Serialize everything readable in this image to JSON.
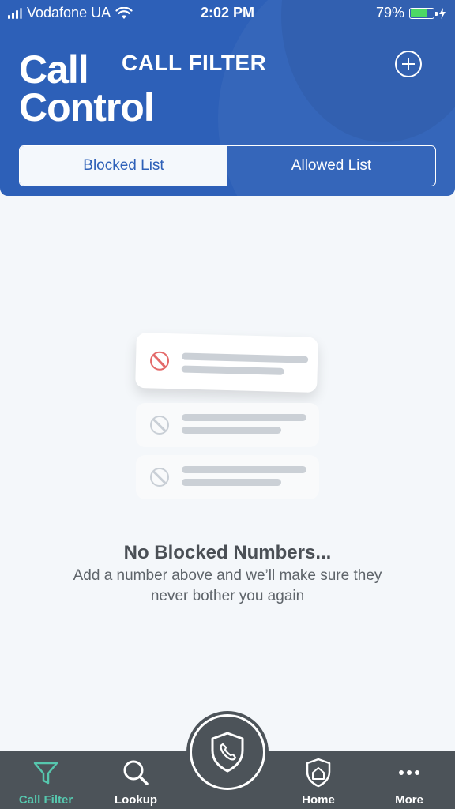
{
  "status_bar": {
    "carrier": "Vodafone UA",
    "time": "2:02 PM",
    "battery_percent": "79%",
    "battery_level": 0.79
  },
  "header": {
    "logo_line1": "Call",
    "logo_line2": "Control",
    "title": "CALL FILTER",
    "add_icon": "plus-circle-icon"
  },
  "tabs": {
    "blocked": "Blocked List",
    "allowed": "Allowed List",
    "active": "blocked"
  },
  "empty_state": {
    "title": "No Blocked Numbers...",
    "subtitle": "Add a number above and we’ll make sure they never bother you again"
  },
  "tab_bar": {
    "items": [
      {
        "label": "Call Filter",
        "icon": "filter-icon",
        "active": true
      },
      {
        "label": "Lookup",
        "icon": "search-icon",
        "active": false
      },
      {
        "label": "Home",
        "icon": "shield-home-icon",
        "active": false
      },
      {
        "label": "More",
        "icon": "more-dots-icon",
        "active": false
      }
    ],
    "center_icon": "shield-phone-icon"
  },
  "colors": {
    "brand_blue": "#2d60b8",
    "tab_bar": "#4c5359",
    "active_tab": "#56c7ae",
    "ban_red": "#e46a6a"
  }
}
